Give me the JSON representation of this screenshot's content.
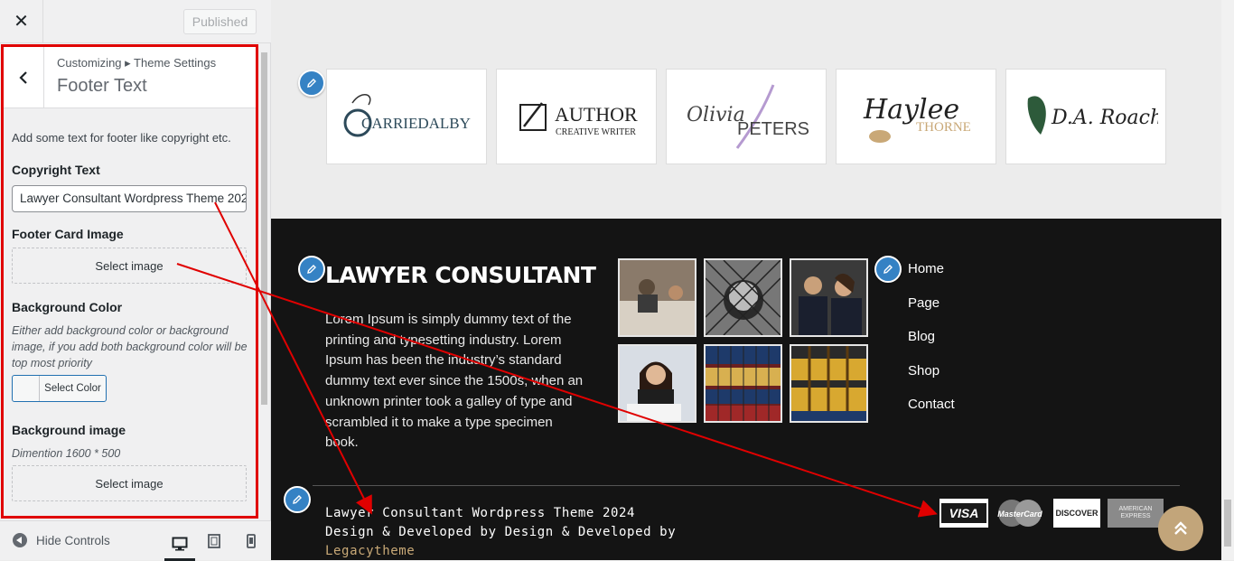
{
  "customizer": {
    "close_icon": "close-icon",
    "publish_label": "Published",
    "breadcrumb": "Customizing ▸ Theme Settings",
    "section_title": "Footer Text",
    "section_description": "Add some text for footer like copyright etc.",
    "copyright": {
      "title": "Copyright Text",
      "value": "Lawyer Consultant Wordpress Theme 2024"
    },
    "footer_card": {
      "title": "Footer Card Image",
      "button": "Select image"
    },
    "bg_color": {
      "title": "Background Color",
      "description": "Either add background color or background image, if you add both background color will be top most priority",
      "button": "Select Color"
    },
    "bg_image": {
      "title": "Background image",
      "description": "Dimention 1600 * 500",
      "button": "Select image"
    },
    "hide_controls": "Hide Controls",
    "devices": [
      "desktop-icon",
      "tablet-icon",
      "mobile-icon"
    ]
  },
  "preview": {
    "logos": [
      {
        "name": "carriedalby-logo",
        "text": "CARRIEDALBY"
      },
      {
        "name": "author-logo",
        "text": "AUTHOR",
        "sub": "CREATIVE WRITER"
      },
      {
        "name": "olivia-peters-logo",
        "text": "Olivia",
        "text2": "PETERS"
      },
      {
        "name": "haylee-thorne-logo",
        "text": "Haylee",
        "text2": "THORNE"
      },
      {
        "name": "da-roach-logo",
        "text": "D.A. Roach"
      }
    ],
    "footer": {
      "brand": "LAWYER CONSULTANT",
      "about": "Lorem Ipsum is simply dummy text of the printing and typesetting industry. Lorem Ipsum has been the industry’s standard dummy text ever since the 1500s, when an unknown printer took a galley of type and scrambled it to make a type specimen book.",
      "menu": [
        "Home",
        "Page",
        "Blog",
        "Shop",
        "Contact"
      ],
      "copyright_text": "Lawyer Consultant Wordpress Theme 2024 Design & Developed by Design & Developed by",
      "copyright_link": "Legacytheme",
      "cards": [
        "VISA",
        "MasterCard",
        "DISCOVER",
        "AMERICAN EXPRESS"
      ]
    }
  },
  "colors": {
    "annotation": "#e00000",
    "edit_pencil": "#3582c4",
    "footer_bg": "#141414",
    "accent": "#c2a57a"
  }
}
